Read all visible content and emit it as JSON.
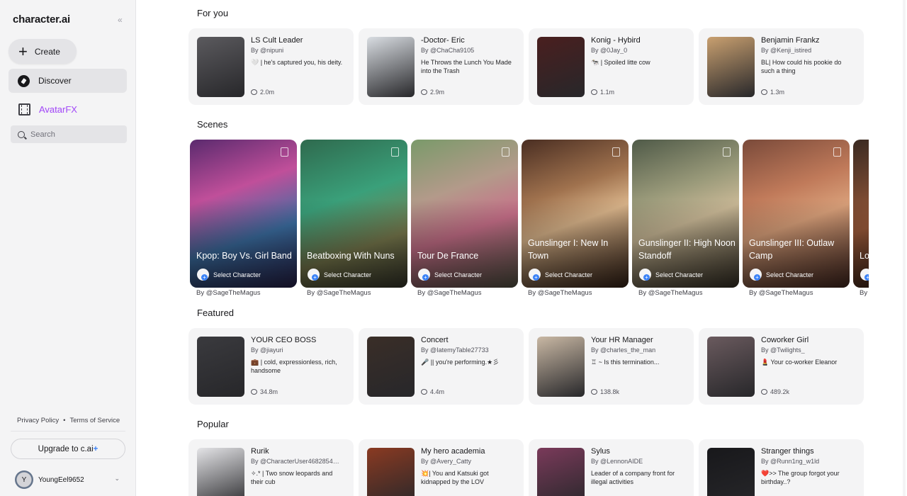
{
  "sidebar": {
    "logo": "character.ai",
    "collapse_icon": "«",
    "create_label": "Create",
    "discover_label": "Discover",
    "avatarfx_label": "AvatarFX",
    "search_placeholder": "Search",
    "privacy": "Privacy Policy",
    "bullet": "•",
    "terms": "Terms of Service",
    "upgrade_label": "Upgrade to c.ai",
    "upgrade_plus": "+",
    "user_initial": "Y",
    "username": "YoungEel9652"
  },
  "sections": {
    "for_you": "For you",
    "scenes": "Scenes",
    "featured": "Featured",
    "popular": "Popular"
  },
  "for_you": [
    {
      "name": "LS Cult Leader",
      "author": "By @nipuni",
      "desc": "🤍 | he's captured you, his deity.",
      "count": "2.0m",
      "color": "#5b5a5e"
    },
    {
      "name": "-Doctor- Eric",
      "author": "By @ChaCha9105",
      "desc": "He Throws the Lunch You Made into the Trash",
      "count": "2.9m",
      "color": "#d9dde2"
    },
    {
      "name": "Konig - Hybird",
      "author": "By @0Jay_0",
      "desc": "🐄 | Spoiled litte cow",
      "count": "1.1m",
      "color": "#4a1f1f"
    },
    {
      "name": "Benjamin Frankz",
      "author": "By @Kenji_istired",
      "desc": "BL| How could his pookie do such a thing",
      "count": "1.3m",
      "color": "#c9a070"
    }
  ],
  "scenes": [
    {
      "title": "Kpop: Boy Vs. Girl Band",
      "select": "Select Character",
      "by": "By @SageTheMagus",
      "bg": "linear-gradient(160deg,#5a2a6e 0%,#c04f9a 35%,#3c6fa3 65%,#2a2350 100%)"
    },
    {
      "title": "Beatboxing With Nuns",
      "select": "Select Character",
      "by": "By @SageTheMagus",
      "bg": "linear-gradient(160deg,#2f6a4e 0%,#3aa07a 40%,#7b7c4f 70%,#3a3a2e 100%)"
    },
    {
      "title": "Tour De France",
      "select": "Select Character",
      "by": "By @SageTheMagus",
      "bg": "linear-gradient(160deg,#7a9a6a 0%,#b39a8a 35%,#c8708a 60%,#5b5a4a 100%)"
    },
    {
      "title": "Gunslinger I: New In Town",
      "select": "Select Character",
      "by": "By @SageTheMagus",
      "bg": "linear-gradient(160deg,#4a2e22 0%,#a0724e 35%,#d9b48a 55%,#3a2418 100%)"
    },
    {
      "title": "Gunslinger II: High Noon Standoff",
      "select": "Select Character",
      "by": "By @SageTheMagus",
      "bg": "linear-gradient(160deg,#4f5a48 0%,#9a9a7a 35%,#c9b896 55%,#3a3428 100%)"
    },
    {
      "title": "Gunslinger III: Outlaw Camp",
      "select": "Select Character",
      "by": "By @SageTheMagus",
      "bg": "linear-gradient(160deg,#7a4a3a 0%,#c07a5a 35%,#d9a07a 55%,#4a2a22 100%)"
    },
    {
      "title": "Lo Av",
      "select": "",
      "by": "By",
      "bg": "linear-gradient(160deg,#3a2a22 0%,#9a5a3a 50%,#2a1a14 100%)"
    }
  ],
  "featured": [
    {
      "name": "YOUR CEO BOSS",
      "author": "By @jiayuri",
      "desc": "💼 | cold, expressionless, rich, handsome",
      "count": "34.8m",
      "color": "#3a3a3e"
    },
    {
      "name": "Concert",
      "author": "By @IatemyTable27733",
      "desc": "🎤 || you're performing.★彡",
      "count": "4.4m",
      "color": "#3a2e28"
    },
    {
      "name": "Your HR Manager",
      "author": "By @charles_the_man",
      "desc": "♖ ~ Is this termination...",
      "count": "138.8k",
      "color": "#c9b8a4"
    },
    {
      "name": "Coworker Girl",
      "author": "By @Twilights_",
      "desc": "💄 Your co-worker Eleanor",
      "count": "489.2k",
      "color": "#6a5a5e"
    }
  ],
  "popular": [
    {
      "name": "Rurik",
      "author": "By @CharacterUser4682854…",
      "desc": "✧.* | Two snow leopards and their cub",
      "count": "",
      "color": "#e4e4e7"
    },
    {
      "name": "My hero academia",
      "author": "By @Avery_Catty",
      "desc": "💥| You and Katsuki got kidnapped by the LOV",
      "count": "",
      "color": "#8a3a22"
    },
    {
      "name": "Sylus",
      "author": "By @LennonAIDE",
      "desc": "Leader of a company front for illegal activities",
      "count": "",
      "color": "#7a3a5a"
    },
    {
      "name": "Stranger things",
      "author": "By @Runn1ng_w1ld",
      "desc": "❤️>> The group forgot your birthday..?",
      "count": "",
      "color": "#18181b"
    }
  ]
}
